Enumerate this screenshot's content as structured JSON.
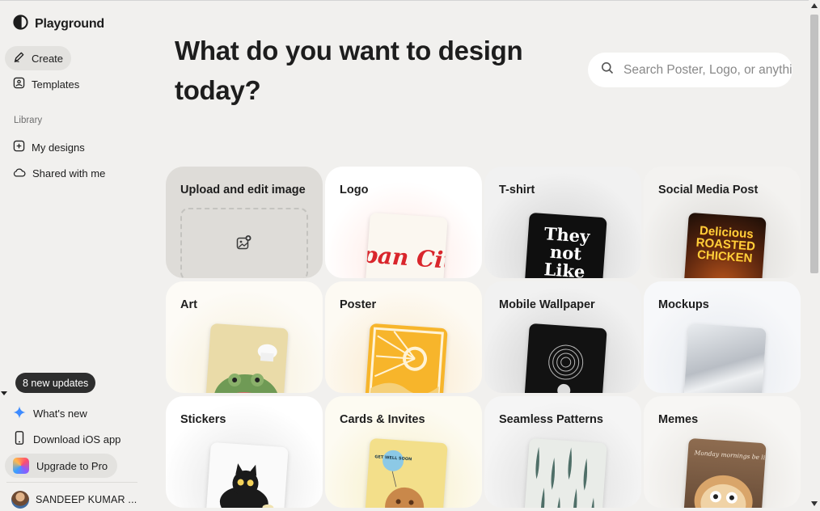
{
  "app": {
    "name": "Playground"
  },
  "sidebar": {
    "nav": [
      {
        "label": "Create",
        "icon": "pen-icon",
        "active": true
      },
      {
        "label": "Templates",
        "icon": "image-frame-icon",
        "active": false
      }
    ],
    "library_label": "Library",
    "library": [
      {
        "label": "My designs",
        "icon": "add-folder-icon"
      },
      {
        "label": "Shared with me",
        "icon": "cloud-icon"
      }
    ],
    "updates_badge": "8 new updates",
    "footer": [
      {
        "label": "What's new",
        "icon": "sparkle-icon"
      },
      {
        "label": "Download iOS app",
        "icon": "phone-icon"
      },
      {
        "label": "Upgrade to Pro",
        "icon": "gem-icon"
      }
    ],
    "user_name": "SANDEEP KUMAR ..."
  },
  "main": {
    "headline": "What do you want to design today?",
    "search_placeholder": "Search Poster, Logo, or anything",
    "cards": [
      {
        "title": "Upload and edit image"
      },
      {
        "title": "Logo",
        "thumb_text": "Span City"
      },
      {
        "title": "T-shirt",
        "thumb_text": "They not Like"
      },
      {
        "title": "Social Media Post",
        "thumb_text": "Delicious ROASTED CHICKEN"
      },
      {
        "title": "Art"
      },
      {
        "title": "Poster"
      },
      {
        "title": "Mobile Wallpaper"
      },
      {
        "title": "Mockups"
      },
      {
        "title": "Stickers"
      },
      {
        "title": "Cards & Invites",
        "thumb_text": "GET WELL SOON"
      },
      {
        "title": "Seamless Patterns"
      },
      {
        "title": "Memes",
        "thumb_text": "Monday mornings be like"
      }
    ]
  },
  "colors": {
    "background": "#f1f0ee",
    "active_pill": "#e3e2df",
    "badge": "#2e2e2e",
    "card": "#ffffff"
  }
}
